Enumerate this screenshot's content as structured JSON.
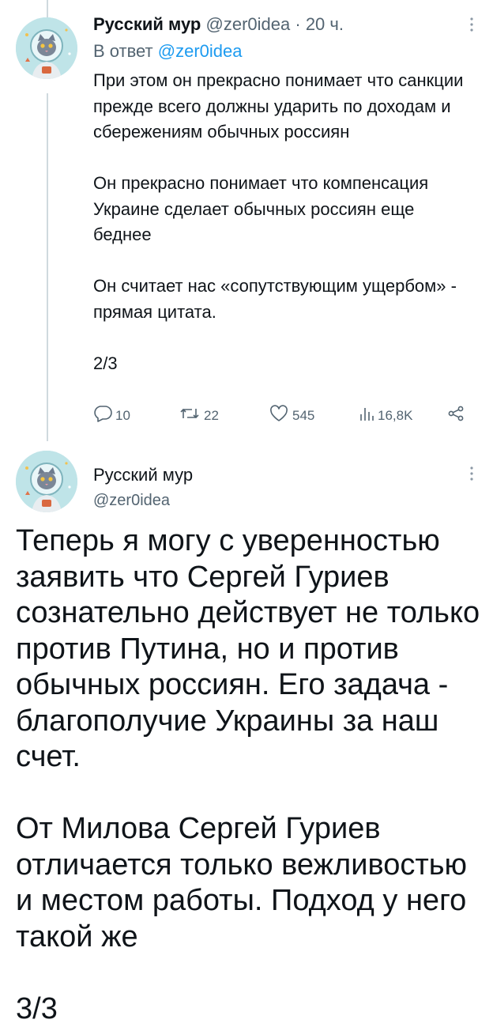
{
  "tweet1": {
    "author_name": "Русский мур",
    "author_handle": "@zer0idea",
    "separator": "·",
    "time": "20 ч.",
    "reply_prefix": "В ответ",
    "reply_mention": "@zer0idea",
    "paragraphs": [
      "При этом он прекрасно понимает что санкции прежде всего должны ударить по доходам и сбережениям обычных россиян",
      "Он прекрасно понимает что компенсация Украине сделает обычных россиян еще беднее",
      "Он считает нас «сопутствующим ущербом» - прямая цитата.",
      "2/3"
    ],
    "actions": {
      "replies": "10",
      "retweets": "22",
      "likes": "545",
      "views": "16,8K"
    }
  },
  "tweet2": {
    "author_name": "Русский мур",
    "author_handle": "@zer0idea",
    "paragraphs": [
      "Теперь я могу с уверенностью заявить что Сергей Гуриев сознательно действует не только против Путина, но и против обычных россиян. Его задача - благополучие Украины за наш счет.",
      "От Милова Сергей Гуриев отличается только вежливостью и местом работы. Подход у него такой же",
      "3/3"
    ]
  },
  "icons": {
    "more": "more-vertical-icon",
    "reply": "reply-icon",
    "retweet": "retweet-icon",
    "like": "heart-icon",
    "views": "views-bar-chart-icon",
    "share": "share-icon"
  },
  "colors": {
    "text": "#0f1419",
    "secondary": "#536471",
    "link": "#1d9bf0",
    "thread_line": "#cfd9de"
  }
}
